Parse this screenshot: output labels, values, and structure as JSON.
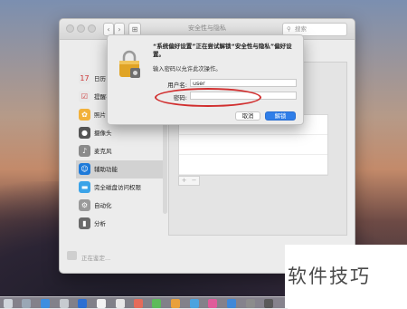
{
  "window": {
    "title": "安全性与隐私",
    "search_placeholder": "搜索"
  },
  "sidebar": {
    "items": [
      {
        "label": "日历",
        "color": "#e8e8e8",
        "glyph": "17"
      },
      {
        "label": "提醒事项",
        "color": "#e8e8e8",
        "glyph": "☑"
      },
      {
        "label": "照片",
        "color": "#f2b13b",
        "glyph": "✿"
      },
      {
        "label": "摄像头",
        "color": "#555555",
        "glyph": "●"
      },
      {
        "label": "麦克风",
        "color": "#8a8a8a",
        "glyph": "♪"
      },
      {
        "label": "辅助功能",
        "color": "#1e7ad9",
        "glyph": "☺"
      },
      {
        "label": "完全磁盘访问权限",
        "color": "#3ba3e8",
        "glyph": "▬"
      },
      {
        "label": "自动化",
        "color": "#9a9a9a",
        "glyph": "⚙"
      },
      {
        "label": "分析",
        "color": "#6a6a6a",
        "glyph": "▮"
      }
    ],
    "selected_index": 5
  },
  "bottom": {
    "lock_status": "正在鉴定..."
  },
  "dialog": {
    "message": "“系统偏好设置”正在尝试解锁“安全性与隐私”偏好设置。",
    "sub": "输入密码以允许此次操作。",
    "username_label": "用户名:",
    "username_value": "user",
    "password_label": "密码:",
    "password_value": "",
    "cancel_label": "取消",
    "unlock_label": "解锁"
  },
  "watermark": {
    "text": "软件技巧"
  },
  "colors": {
    "accent": "#2f7ee8",
    "annotation": "#d12e2e"
  }
}
